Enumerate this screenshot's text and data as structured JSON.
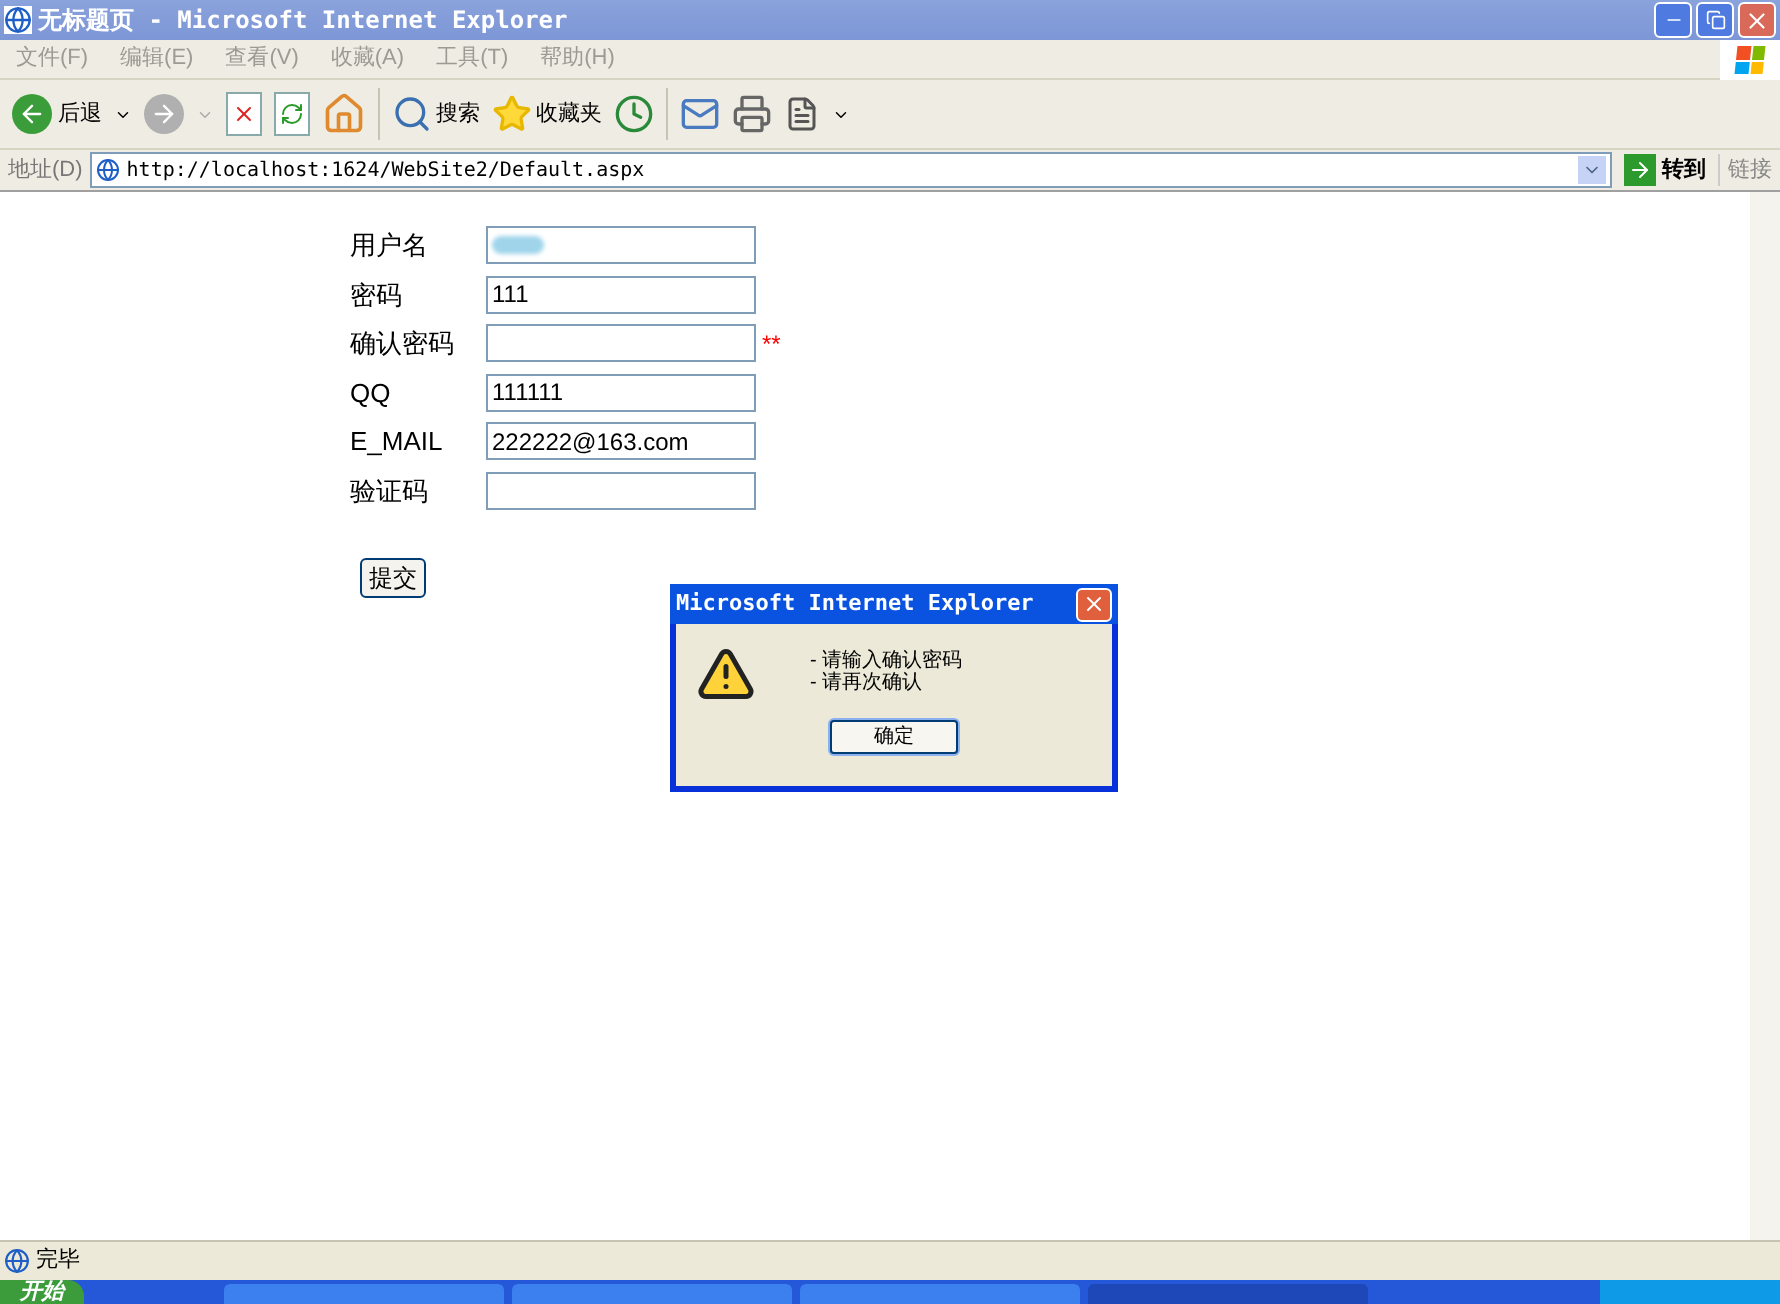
{
  "window": {
    "title": "无标题页 - Microsoft Internet Explorer"
  },
  "menu": [
    "文件(F)",
    "编辑(E)",
    "查看(V)",
    "收藏(A)",
    "工具(T)",
    "帮助(H)"
  ],
  "toolbar": {
    "back": "后退",
    "search": "搜索",
    "favorites": "收藏夹"
  },
  "address": {
    "label": "地址(D)",
    "url": "http://localhost:1624/WebSite2/Default.aspx",
    "go": "转到",
    "links": "链接"
  },
  "form": {
    "fields": [
      {
        "label": "用户名",
        "kind": "blurred"
      },
      {
        "label": "密码",
        "kind": "text",
        "value": "111"
      },
      {
        "label": "确认密码",
        "kind": "text",
        "error": "**"
      },
      {
        "label": "QQ",
        "kind": "text",
        "value": "111111"
      },
      {
        "label": "E_MAIL",
        "kind": "text",
        "value": "222222@163.com"
      },
      {
        "label": "验证码",
        "kind": "text"
      }
    ],
    "submit": "提交"
  },
  "dialog": {
    "title": "Microsoft Internet Explorer",
    "messages": [
      "- 请输入确认密码",
      "- 请再次确认"
    ],
    "ok": "确定"
  },
  "status_bar": {
    "text": "完毕"
  },
  "taskbar": {
    "start": "开始"
  }
}
